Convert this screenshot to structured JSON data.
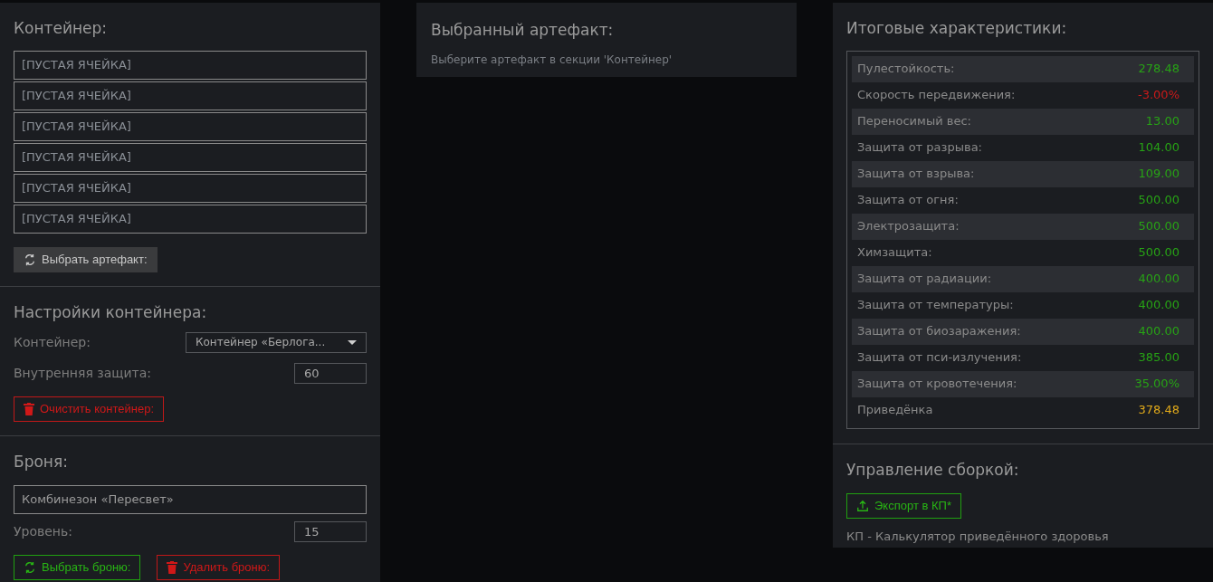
{
  "container": {
    "title": "Контейнер:",
    "slots": [
      "[ПУСТАЯ ЯЧЕЙКА]",
      "[ПУСТАЯ ЯЧЕЙКА]",
      "[ПУСТАЯ ЯЧЕЙКА]",
      "[ПУСТАЯ ЯЧЕЙКА]",
      "[ПУСТАЯ ЯЧЕЙКА]",
      "[ПУСТАЯ ЯЧЕЙКА]"
    ],
    "button": {
      "label": "Выбрать артефакт:",
      "kind": "select"
    }
  },
  "container_settings": {
    "title": "Настройки контейнера:",
    "container_label": "Контейнер:",
    "container_value": "Контейнер «Берлога...",
    "protection_label": "Внутренняя защита:",
    "protection_value": "60",
    "button": {
      "label": "Очистить контейнер:",
      "kind": "delete"
    }
  },
  "armor": {
    "title": "Броня:",
    "name": "Комбинезон «Пересвет»",
    "level_label": "Уровень:",
    "level_value": "15",
    "buttons": [
      {
        "label": "Выбрать броню:",
        "kind": "confirm"
      },
      {
        "label": "Удалить броню:",
        "kind": "delete"
      }
    ]
  },
  "selected_artifact": {
    "title": "Выбранный артефакт:",
    "hint": "Выберите артефакт в секции 'Контейнер'"
  },
  "totals": {
    "title": "Итоговые характеристики:",
    "rows": [
      {
        "label": "Пулестойкость:",
        "value": "278.48",
        "kind": "positive"
      },
      {
        "label": "Скорость передвижения:",
        "value": "-3.00%",
        "kind": "negative"
      },
      {
        "label": "Переносимый вес:",
        "value": "13.00",
        "kind": "positive"
      },
      {
        "label": "Защита от разрыва:",
        "value": "104.00",
        "kind": "positive"
      },
      {
        "label": "Защита от взрыва:",
        "value": "109.00",
        "kind": "positive"
      },
      {
        "label": "Защита от огня:",
        "value": "500.00",
        "kind": "positive"
      },
      {
        "label": "Электрозащита:",
        "value": "500.00",
        "kind": "positive"
      },
      {
        "label": "Химзащита:",
        "value": "500.00",
        "kind": "positive"
      },
      {
        "label": "Защита от радиации:",
        "value": "400.00",
        "kind": "positive"
      },
      {
        "label": "Защита от температуры:",
        "value": "400.00",
        "kind": "positive"
      },
      {
        "label": "Защита от биозаражения:",
        "value": "400.00",
        "kind": "positive"
      },
      {
        "label": "Защита от пси-излучения:",
        "value": "385.00",
        "kind": "positive"
      },
      {
        "label": "Защита от кровотечения:",
        "value": "35.00%",
        "kind": "positive"
      },
      {
        "label": "Приведёнка",
        "value": "378.48",
        "kind": "total"
      }
    ]
  },
  "build": {
    "title": "Управление сборкой:",
    "button": {
      "label": "Экспорт в КП*",
      "kind": "export"
    },
    "note": "КП - Калькулятор приведённого здоровья"
  }
}
